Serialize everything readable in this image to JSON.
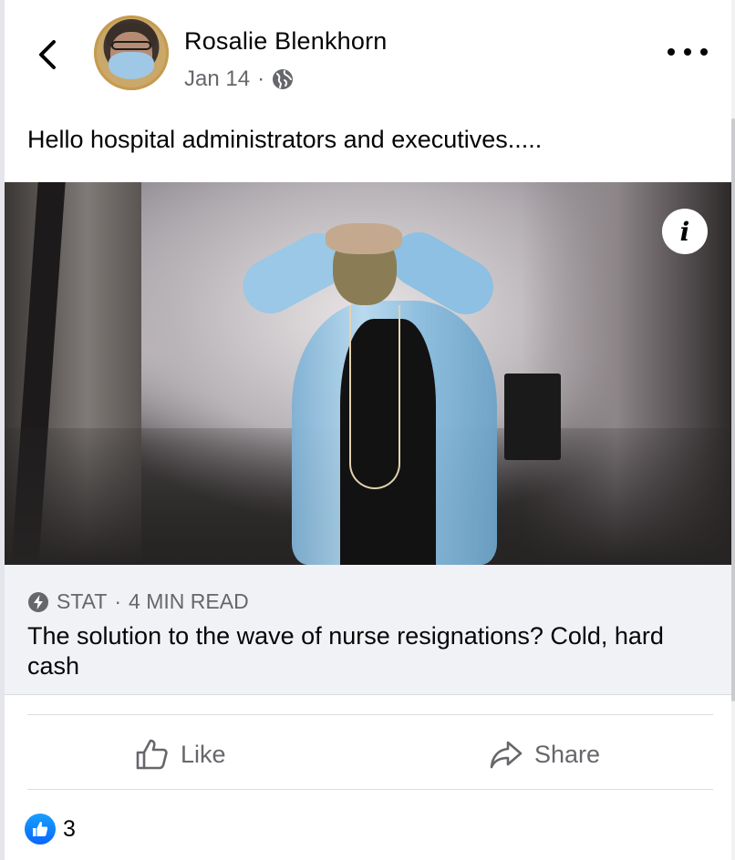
{
  "post": {
    "author": "Rosalie Blenkhorn",
    "date": "Jan 14",
    "separator": "·",
    "text": "Hello hospital administrators and executives.....",
    "privacy_icon": "globe-icon"
  },
  "link": {
    "source": "STAT",
    "separator": "·",
    "read_time": "4 MIN READ",
    "title": "The solution to the wave of nurse resignations? Cold, hard cash"
  },
  "actions": {
    "like_label": "Like",
    "share_label": "Share"
  },
  "reactions": {
    "count": "3"
  },
  "colors": {
    "accent": "#0866ff",
    "secondary_text": "#65676b",
    "card_bg": "#f0f2f5"
  }
}
